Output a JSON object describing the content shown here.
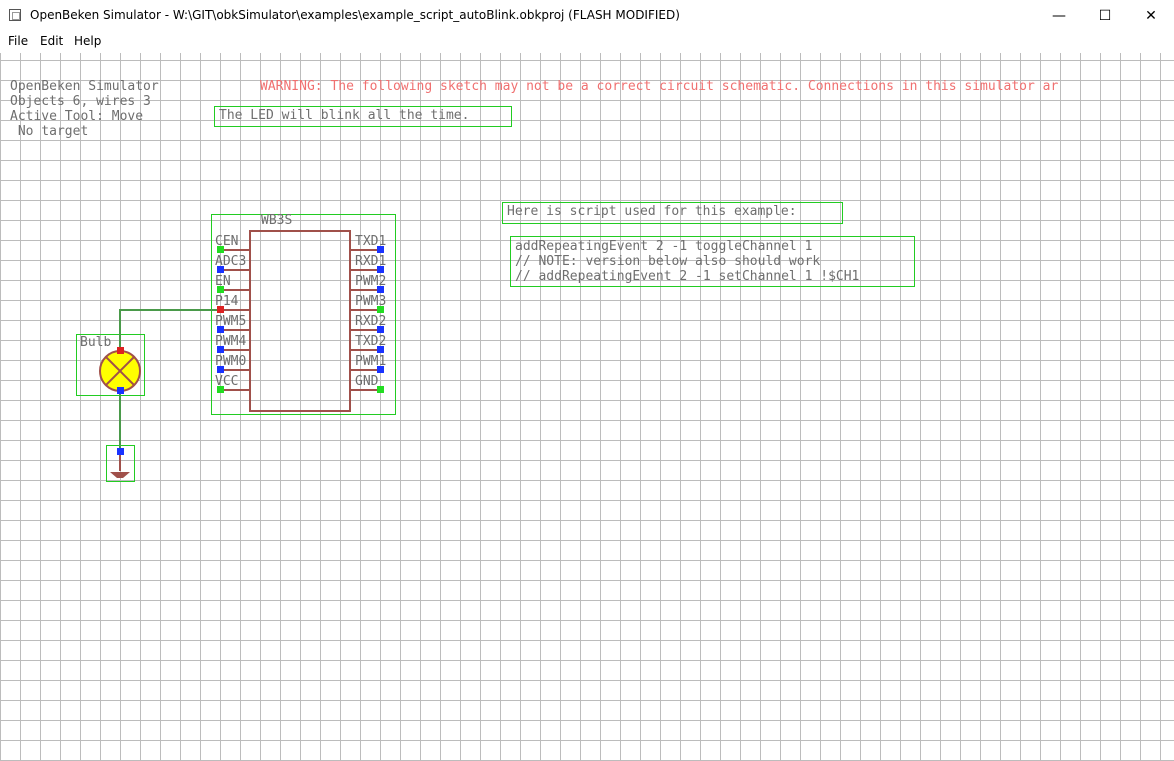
{
  "window": {
    "title": "OpenBeken Simulator - W:\\GIT\\obkSimulator\\examples\\example_script_autoBlink.obkproj (FLASH MODIFIED)",
    "minimize_glyph": "—",
    "maximize_glyph": "☐",
    "close_glyph": "✕"
  },
  "menu": {
    "file": "File",
    "edit": "Edit",
    "help": "Help"
  },
  "status": {
    "line1": "OpenBeken Simulator",
    "line2": "Objects 6, wires 3",
    "line3": "Active Tool: Move",
    "line4": " No target"
  },
  "warning": "WARNING: The following sketch may not be a correct circuit schematic. Connections in this simulator ar",
  "note_led": "The LED will blink all the time.",
  "note_script": "Here is script used for this example:",
  "script_lines": [
    "addRepeatingEvent 2 -1 toggleChannel 1",
    "// NOTE: version below also should work",
    "// addRepeatingEvent 2 -1 setChannel 1 !$CH1"
  ],
  "chip": {
    "name": "WB3S",
    "left_pins": [
      "CEN",
      "ADC3",
      "EN",
      "P14",
      "PWM5",
      "PWM4",
      "PWM0",
      "VCC"
    ],
    "right_pins": [
      "TXD1",
      "RXD1",
      "PWM2",
      "PWM3",
      "RXD2",
      "TXD2",
      "PWM1",
      "GND"
    ]
  },
  "bulb": {
    "label": "Bulb"
  },
  "colors": {
    "grid": "#bcbcbc",
    "selection": "#22cc22",
    "text": "#6e6e6e",
    "warning": "#f07070",
    "component": "#a0504a",
    "wire": "#4a9a4a"
  }
}
